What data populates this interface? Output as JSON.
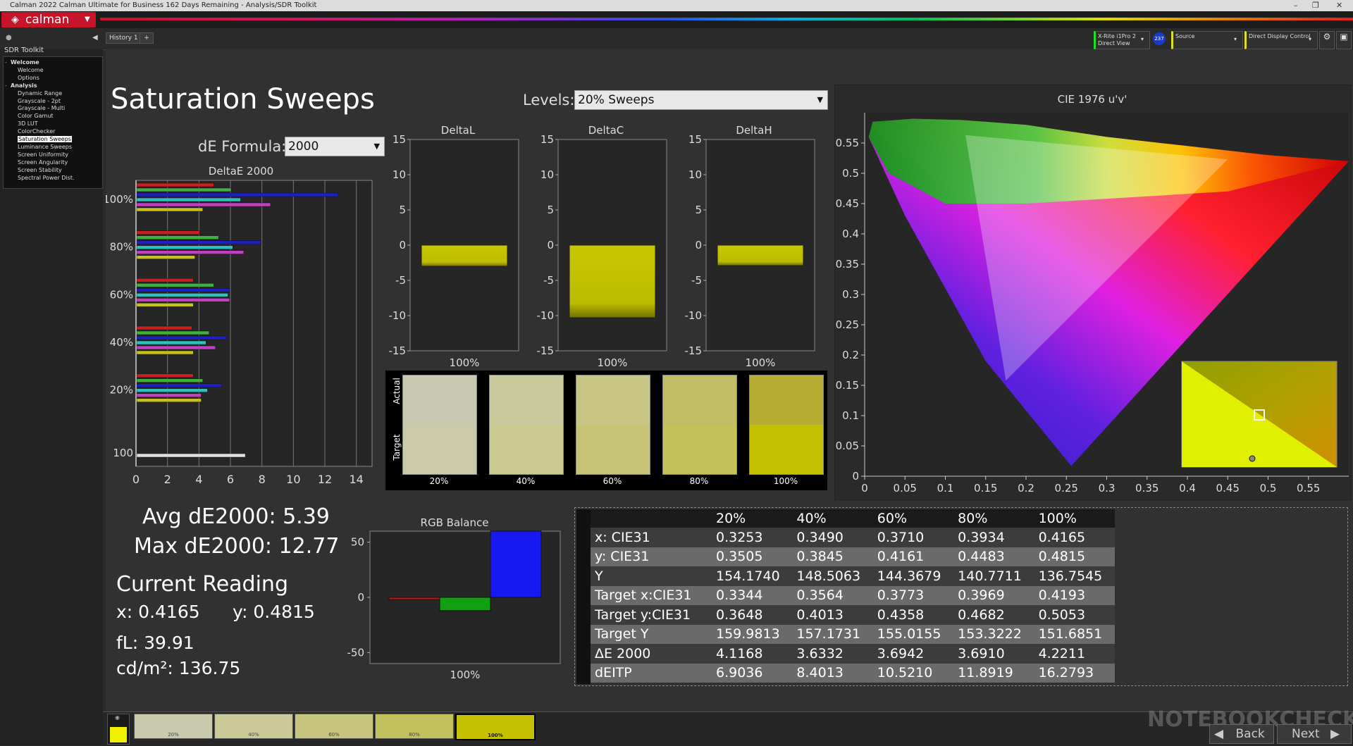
{
  "window": {
    "title": "Calman 2022 Calman Ultimate for Business 162 Days Remaining  - Analysis/SDR Toolkit",
    "controls": [
      "–",
      "❐",
      "✕"
    ]
  },
  "app": {
    "logo": "calman",
    "brand_color": "#c8142a"
  },
  "toolbar": {
    "history_tab": "History 1",
    "meter": {
      "line1": "X-Rite i1Pro 2",
      "line2": "Direct View",
      "badge": "237"
    },
    "source": "Source",
    "display": "Direct Display Control"
  },
  "sidebar": {
    "title": "SDR Toolkit",
    "items": [
      {
        "label": "Welcome",
        "bold": true,
        "level": 0
      },
      {
        "label": "Welcome",
        "level": 1
      },
      {
        "label": "Options",
        "level": 1
      },
      {
        "label": "Analysis",
        "bold": true,
        "level": 0
      },
      {
        "label": "Dynamic Range",
        "level": 1
      },
      {
        "label": "Grayscale - 2pt",
        "level": 1
      },
      {
        "label": "Grayscale - Multi",
        "level": 1
      },
      {
        "label": "Color Gamut",
        "level": 1
      },
      {
        "label": "3D LUT",
        "level": 1
      },
      {
        "label": "ColorChecker",
        "level": 1
      },
      {
        "label": "Saturation Sweeps",
        "level": 1,
        "selected": true
      },
      {
        "label": "Luminance Sweeps",
        "level": 1
      },
      {
        "label": "Screen Uniformity",
        "level": 1
      },
      {
        "label": "Screen Angularity",
        "level": 1
      },
      {
        "label": "Screen Stability",
        "level": 1
      },
      {
        "label": "Spectral Power Dist.",
        "level": 1
      }
    ]
  },
  "page": {
    "title": "Saturation Sweeps",
    "levels_label": "Levels:",
    "levels_value": "20% Sweeps",
    "de_formula_label": "dE Formula:",
    "de_formula_value": "2000"
  },
  "deltae_chart": {
    "title": "DeltaE 2000",
    "xticks": [
      "0",
      "2",
      "4",
      "6",
      "8",
      "10",
      "12",
      "14"
    ],
    "groups": [
      {
        "label": "100%",
        "values": [
          4.9,
          6.0,
          12.8,
          6.6,
          8.5,
          4.2
        ]
      },
      {
        "label": "80%",
        "values": [
          4.0,
          5.2,
          7.9,
          6.1,
          6.8,
          3.7
        ]
      },
      {
        "label": "60%",
        "values": [
          3.6,
          4.9,
          5.9,
          5.8,
          5.9,
          3.6
        ]
      },
      {
        "label": "40%",
        "values": [
          3.5,
          4.6,
          5.7,
          4.4,
          5.0,
          3.6
        ]
      },
      {
        "label": "20%",
        "values": [
          3.6,
          4.2,
          5.4,
          4.5,
          4.1,
          4.1
        ]
      },
      {
        "label": "100",
        "values": [
          6.9
        ]
      }
    ],
    "colors": [
      "#c82020",
      "#40b040",
      "#2020c0",
      "#30c0c0",
      "#c040c0",
      "#c8c020"
    ],
    "xlim": [
      0,
      15
    ]
  },
  "delta_charts": [
    {
      "title": "DeltaL",
      "value": -3.0,
      "label": "100%"
    },
    {
      "title": "DeltaC",
      "value": -10.3,
      "label": "100%"
    },
    {
      "title": "DeltaH",
      "value": -2.9,
      "label": "100%"
    }
  ],
  "delta_ticks": [
    "15",
    "10",
    "5",
    "0",
    "-5",
    "-10",
    "-15"
  ],
  "swatches": {
    "actual_label": "Actual",
    "target_label": "Target",
    "items": [
      {
        "label": "20%",
        "actual": "#c9c9b1",
        "target": "#cbcba9"
      },
      {
        "label": "40%",
        "actual": "#cbca9c",
        "target": "#cbca90"
      },
      {
        "label": "60%",
        "actual": "#c8c585",
        "target": "#c7c575"
      },
      {
        "label": "80%",
        "actual": "#c2bd64",
        "target": "#c3c157"
      },
      {
        "label": "100%",
        "actual": "#b8ad34",
        "target": "#c2c000"
      }
    ]
  },
  "stats": {
    "avg": "Avg dE2000: 5.39",
    "max": "Max dE2000: 12.77",
    "current_reading": "Current Reading",
    "x": "x: 0.4165",
    "y": "y: 0.4815",
    "fl": "fL: 39.91",
    "cdm2": "cd/m²: 136.75"
  },
  "rgb_balance": {
    "title": "RGB Balance",
    "yticks": [
      "50",
      "0",
      "-50"
    ],
    "label": "100%",
    "values": [
      {
        "name": "R",
        "value": -2,
        "color": "#c01818"
      },
      {
        "name": "G",
        "value": -12,
        "color": "#10a010"
      },
      {
        "name": "B",
        "value": 60,
        "color": "#1818f0"
      }
    ],
    "ylim": [
      -60,
      60
    ]
  },
  "cie_chart": {
    "title": "CIE 1976 u'v'",
    "xticks": [
      "0",
      "0.05",
      "0.1",
      "0.15",
      "0.2",
      "0.25",
      "0.3",
      "0.35",
      "0.4",
      "0.45",
      "0.5",
      "0.55"
    ],
    "yticks": [
      "0",
      "0.05",
      "0.1",
      "0.15",
      "0.2",
      "0.25",
      "0.3",
      "0.35",
      "0.4",
      "0.45",
      "0.5",
      "0.55"
    ],
    "xlim": [
      0,
      0.6
    ],
    "ylim": [
      0,
      0.6
    ]
  },
  "table": {
    "headers": [
      "",
      "20%",
      "40%",
      "60%",
      "80%",
      "100%"
    ],
    "rows": [
      [
        "x: CIE31",
        "0.3253",
        "0.3490",
        "0.3710",
        "0.3934",
        "0.4165"
      ],
      [
        "y: CIE31",
        "0.3505",
        "0.3845",
        "0.4161",
        "0.4483",
        "0.4815"
      ],
      [
        "Y",
        "154.1740",
        "148.5063",
        "144.3679",
        "140.7711",
        "136.7545"
      ],
      [
        "Target x:CIE31",
        "0.3344",
        "0.3564",
        "0.3773",
        "0.3969",
        "0.4193"
      ],
      [
        "Target y:CIE31",
        "0.3648",
        "0.4013",
        "0.4358",
        "0.4682",
        "0.5053"
      ],
      [
        "Target Y",
        "159.9813",
        "157.1731",
        "155.0155",
        "153.3222",
        "151.6851"
      ],
      [
        "ΔE 2000",
        "4.1168",
        "3.6332",
        "3.6942",
        "3.6910",
        "4.2211"
      ],
      [
        "dEITP",
        "6.9036",
        "8.4013",
        "10.5210",
        "11.8919",
        "16.2793"
      ]
    ]
  },
  "bottom": {
    "current_color": "#f0f000",
    "swatches": [
      {
        "label": "20%",
        "color": "#c9c9ad"
      },
      {
        "label": "40%",
        "color": "#cbca98"
      },
      {
        "label": "60%",
        "color": "#c7c57f"
      },
      {
        "label": "80%",
        "color": "#c3c15d"
      },
      {
        "label": "100%",
        "color": "#c2c000"
      }
    ],
    "back": "Back",
    "next": "Next",
    "watermark": "NOTEBOOKCHECK"
  }
}
